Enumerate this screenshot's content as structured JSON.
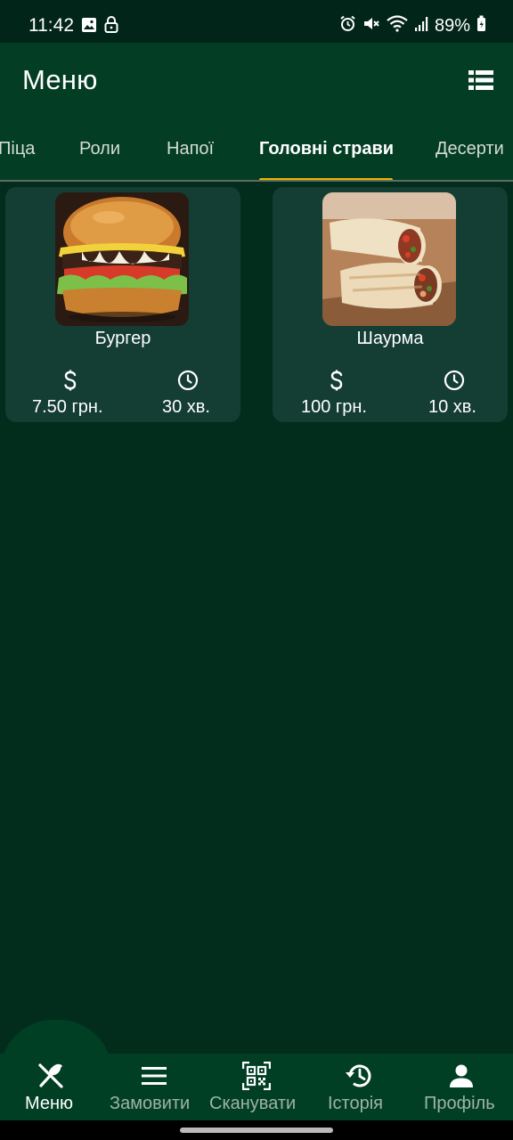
{
  "status_bar": {
    "time": "11:42",
    "battery": "89%",
    "icons": [
      "gallery-icon",
      "lock-icon",
      "alarm-icon",
      "mute-icon",
      "wifi-icon",
      "signal-icon",
      "battery-icon"
    ]
  },
  "app_bar": {
    "title": "Меню",
    "action_icon": "list-view-icon"
  },
  "tabs": [
    {
      "label": "Піца",
      "active": false
    },
    {
      "label": "Роли",
      "active": false
    },
    {
      "label": "Напої",
      "active": false
    },
    {
      "label": "Головні страви",
      "active": true
    },
    {
      "label": "Десерти",
      "active": false
    }
  ],
  "dishes": [
    {
      "name": "Бургер",
      "price": "7.50 грн.",
      "time": "30 хв.",
      "image": "burger-image"
    },
    {
      "name": "Шаурма",
      "price": "100 грн.",
      "time": "10 хв.",
      "image": "shawarma-image"
    }
  ],
  "bottom_nav": [
    {
      "label": "Меню",
      "icon": "fork-knife-icon",
      "active": true
    },
    {
      "label": "Замовити",
      "icon": "menu-lines-icon",
      "active": false
    },
    {
      "label": "Сканувати",
      "icon": "qr-code-icon",
      "active": false
    },
    {
      "label": "Історія",
      "icon": "history-icon",
      "active": false
    },
    {
      "label": "Профіль",
      "icon": "person-icon",
      "active": false
    }
  ],
  "colors": {
    "background": "#022d1c",
    "app_bar": "#033d24",
    "card": "#143d33",
    "tab_indicator": "#f2b400",
    "inactive_nav_label": "#9fb3a7"
  }
}
